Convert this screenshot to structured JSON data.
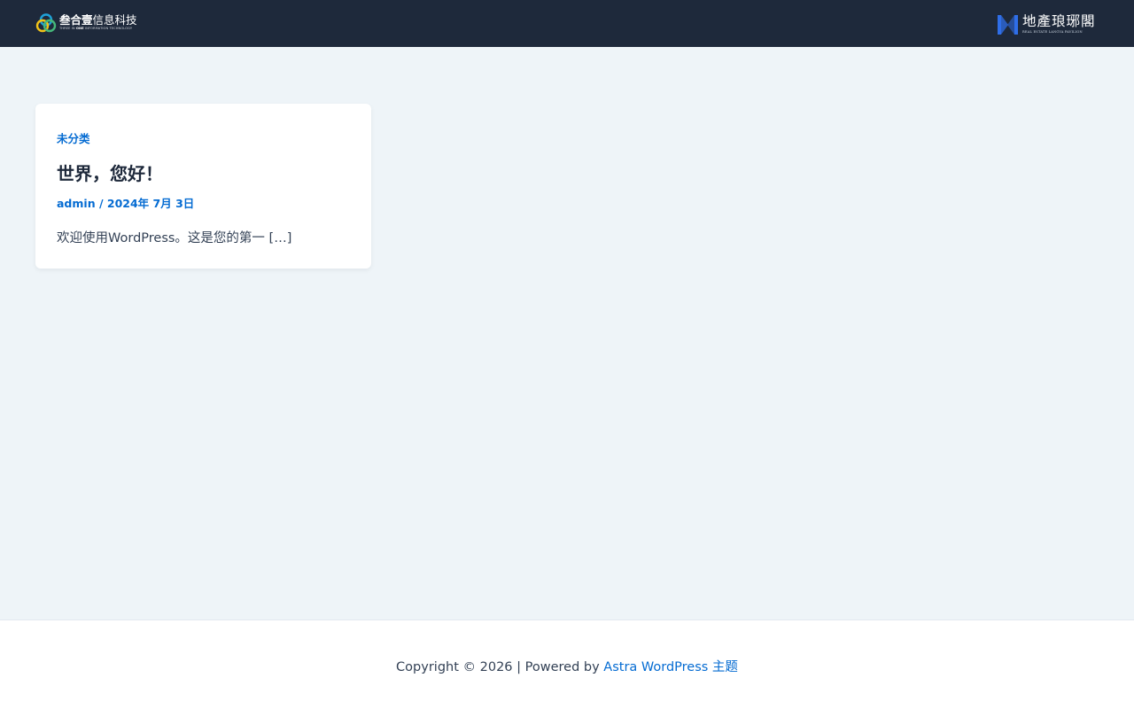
{
  "header": {
    "left_logo": {
      "name_bold": "叁合壹",
      "name_regular": "信息科技",
      "tagline_prefix": "THREE IN ",
      "tagline_bold": "ONE",
      "tagline_suffix": " INFORMATION TECHNOLOGY",
      "icon": "tricolor-rings-logo",
      "colors": [
        "#1fa1d8",
        "#f2c318",
        "#46b77a"
      ]
    },
    "right_logo": {
      "name": "地產琅琊閣",
      "tagline": "REAL ESTATE LANGYA PAVILION",
      "icon": "blue-bracket-logo",
      "color": "#2f6ee8"
    }
  },
  "post": {
    "category": "未分类",
    "title": "世界，您好！",
    "author": "admin",
    "separator": " / ",
    "date": "2024年 7月 3日",
    "excerpt": "欢迎使用WordPress。这是您的第一 […]"
  },
  "footer": {
    "copyright": "Copyright © 2026 | Powered by ",
    "theme_link": "Astra WordPress 主题"
  },
  "colors": {
    "header_bg": "#1e293b",
    "page_bg": "#eef4f8",
    "accent": "#046bd2",
    "heading": "#1e293b",
    "text": "#334155"
  }
}
